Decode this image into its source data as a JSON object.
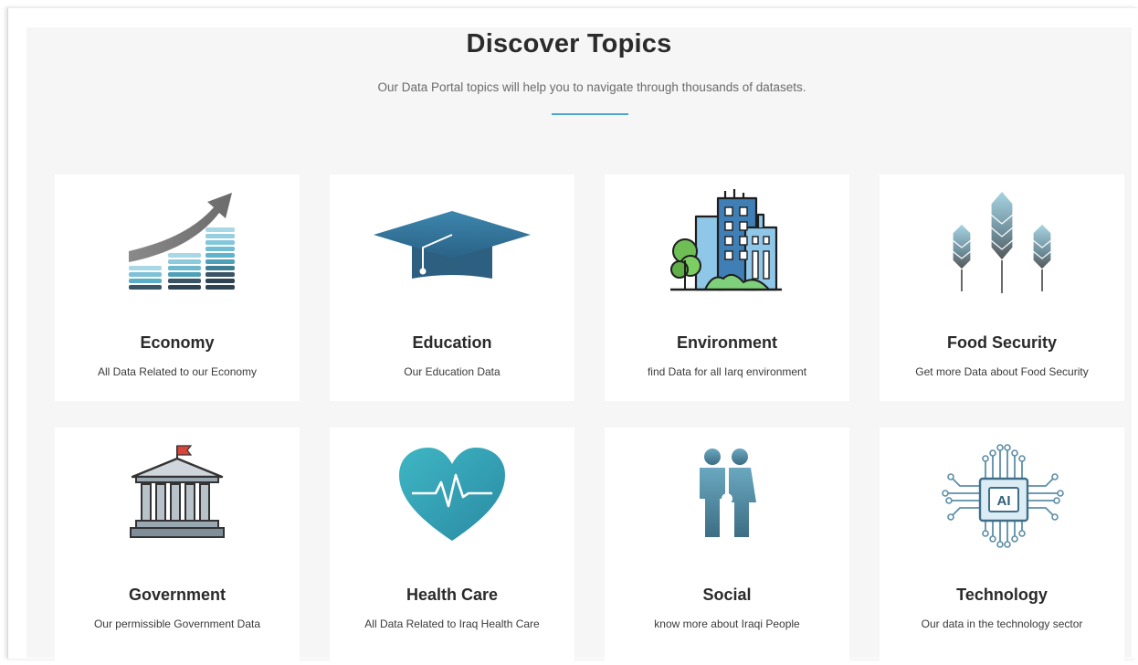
{
  "header": {
    "title": "Discover Topics",
    "subtitle": "Our Data Portal topics will help you to navigate through thousands of datasets."
  },
  "accent_color": "#4aa6d0",
  "topics": [
    {
      "title": "Economy",
      "description": "All Data Related to our Economy",
      "icon": "growth-chart-icon"
    },
    {
      "title": "Education",
      "description": "Our Education Data",
      "icon": "graduation-cap-icon"
    },
    {
      "title": "Environment",
      "description": "find Data for all Iarq environment",
      "icon": "city-buildings-icon"
    },
    {
      "title": "Food Security",
      "description": "Get more Data about Food Security",
      "icon": "wheat-icon"
    },
    {
      "title": "Government",
      "description": "Our permissible Government Data",
      "icon": "government-building-icon"
    },
    {
      "title": "Health Care",
      "description": "All Data Related to Iraq Health Care",
      "icon": "heart-pulse-icon"
    },
    {
      "title": "Social",
      "description": "know more about Iraqi People",
      "icon": "family-icon"
    },
    {
      "title": "Technology",
      "description": "Our data in the technology sector",
      "icon": "ai-chip-icon"
    }
  ]
}
